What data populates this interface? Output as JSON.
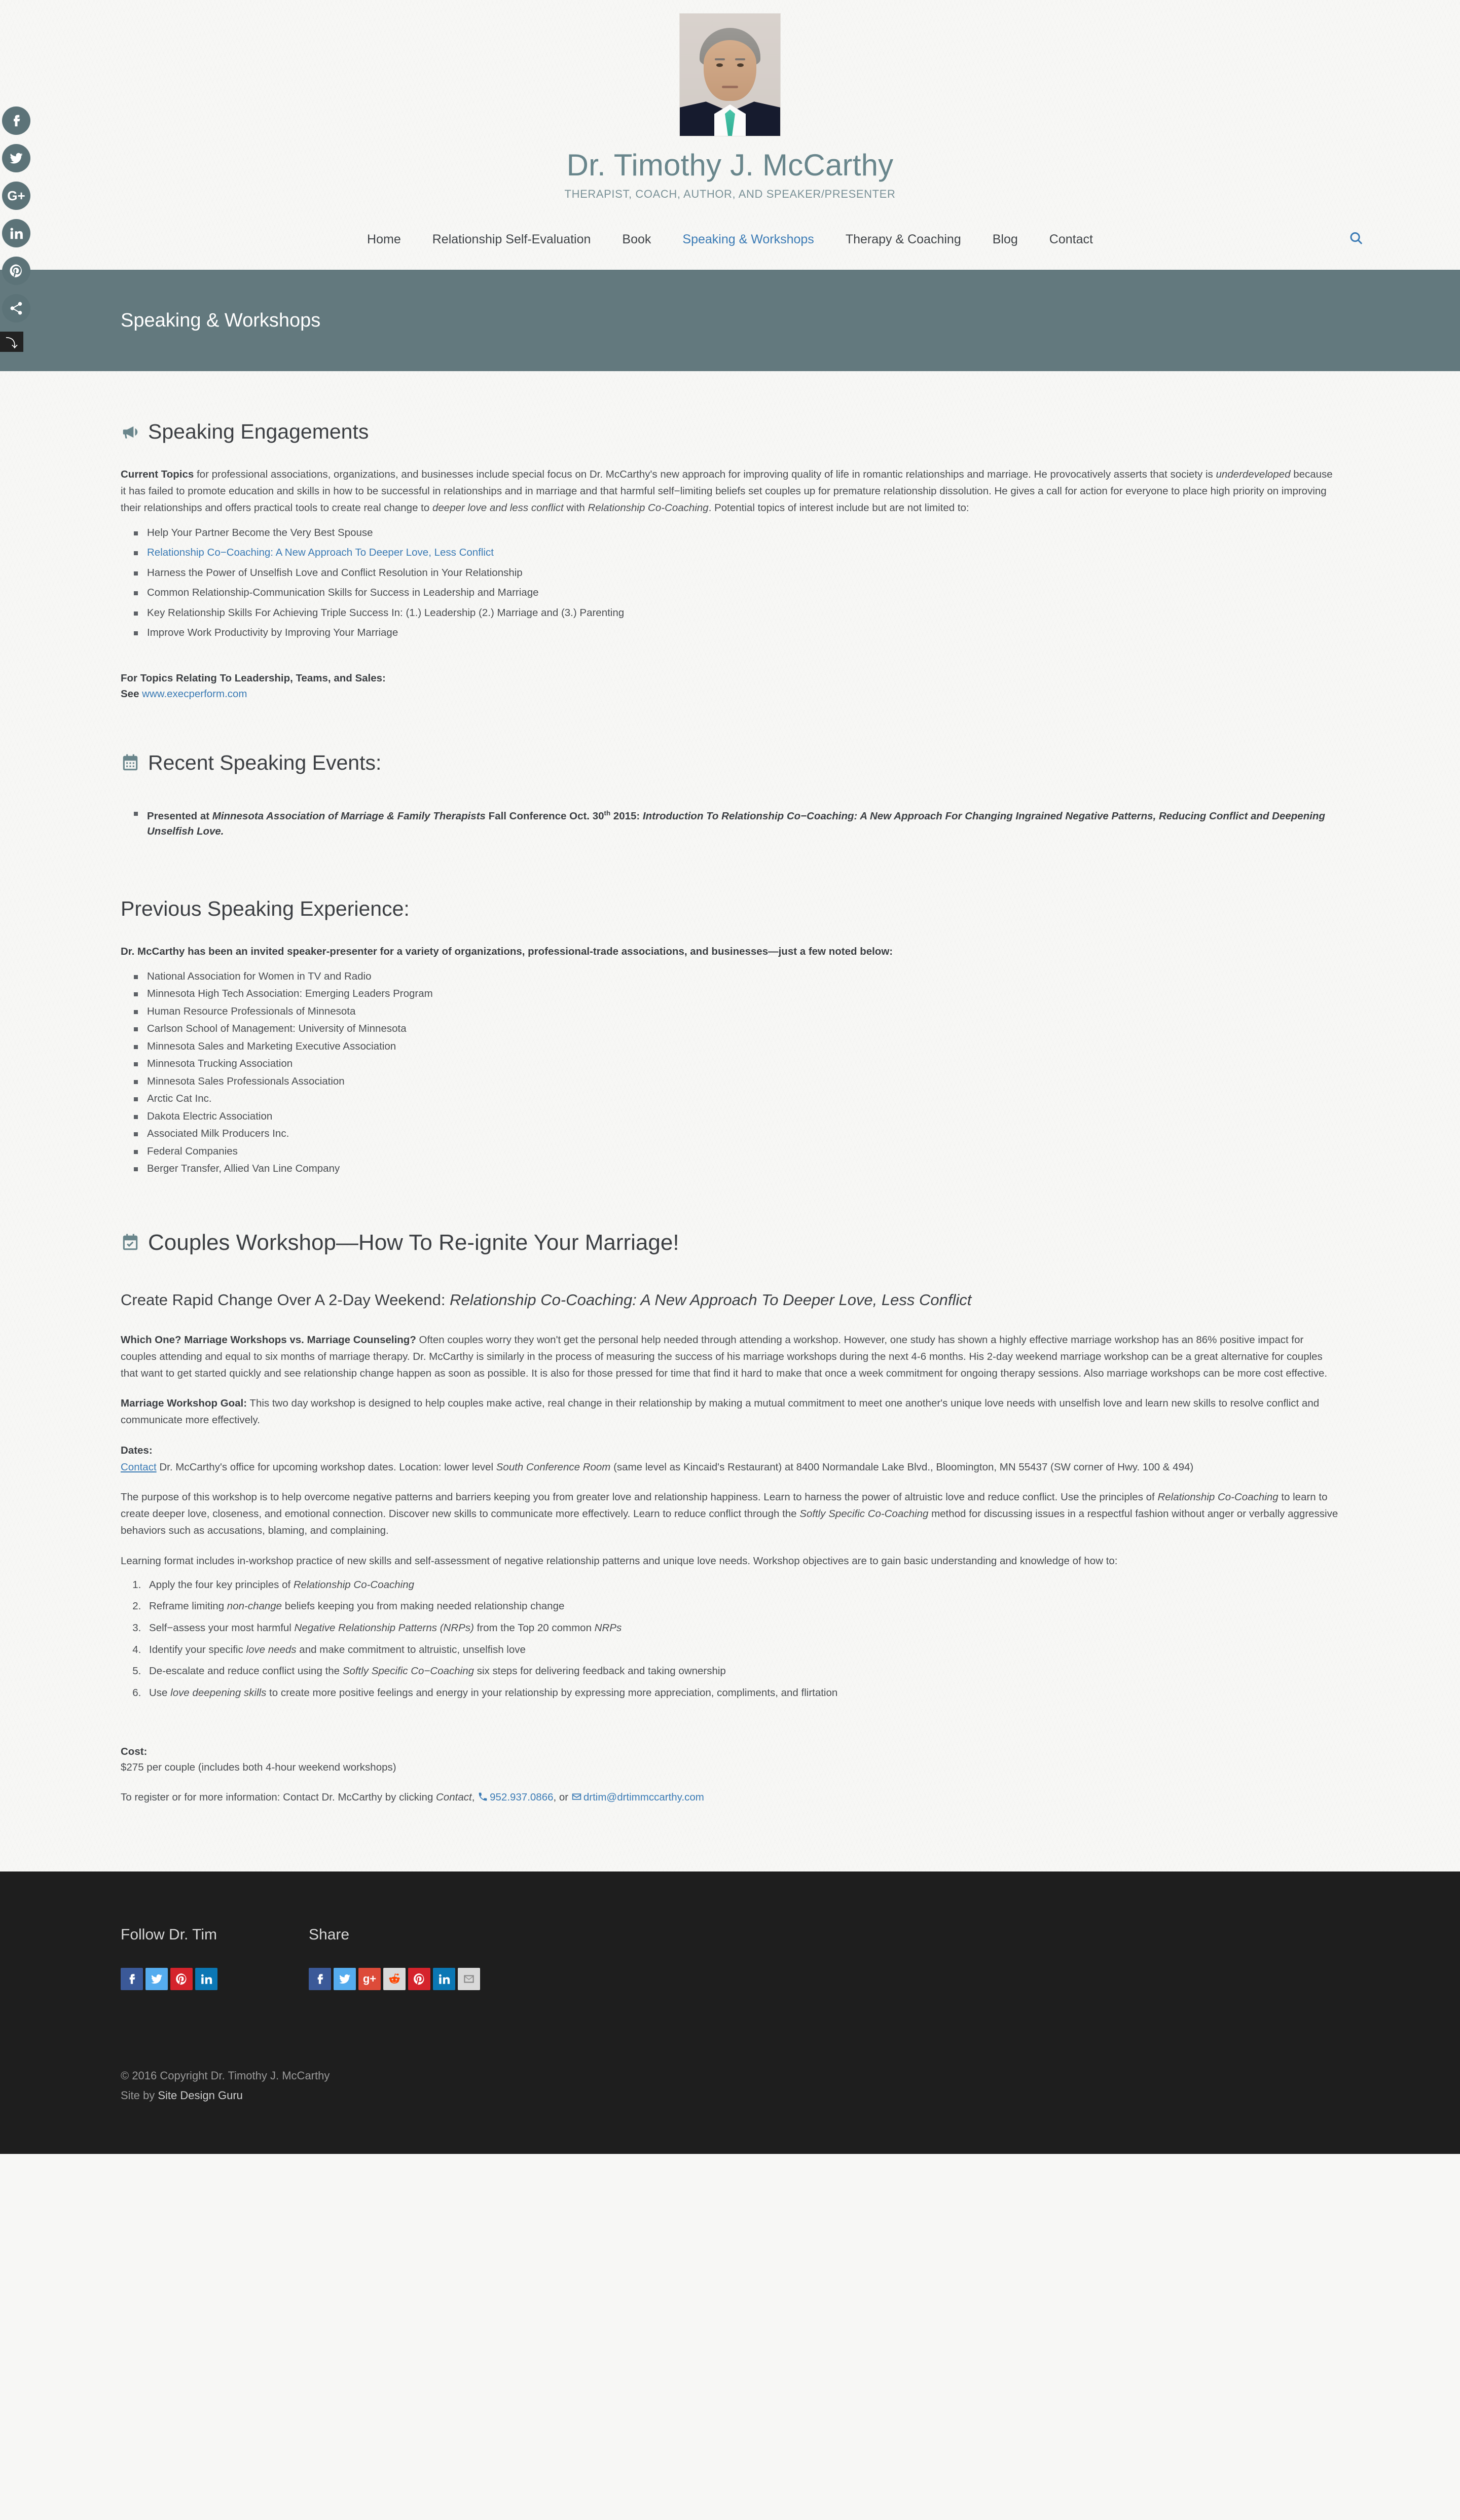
{
  "site": {
    "title": "Dr. Timothy J. McCarthy",
    "tagline": "THERAPIST, COACH, AUTHOR, AND SPEAKER/PRESENTER",
    "portrait_alt": "Portrait of Dr. Timothy J. McCarthy",
    "accent_blue": "#3b7bb5",
    "accent_teal": "#63797e"
  },
  "social_rail": [
    {
      "name": "facebook-icon",
      "label": "f"
    },
    {
      "name": "twitter-icon",
      "label": "t"
    },
    {
      "name": "google-plus-icon",
      "label": "G+"
    },
    {
      "name": "linkedin-icon",
      "label": "in"
    },
    {
      "name": "pinterest-icon",
      "label": "P"
    },
    {
      "name": "share-icon",
      "label": "share"
    },
    {
      "name": "collapse-icon",
      "label": "↵"
    }
  ],
  "nav": {
    "items": [
      {
        "label": "Home",
        "active": false
      },
      {
        "label": "Relationship Self-Evaluation",
        "active": false
      },
      {
        "label": "Book",
        "active": false
      },
      {
        "label": "Speaking & Workshops",
        "active": true
      },
      {
        "label": "Therapy & Coaching",
        "active": false
      },
      {
        "label": "Blog",
        "active": false
      },
      {
        "label": "Contact",
        "active": false
      }
    ],
    "search_icon": "search-icon"
  },
  "banner": {
    "title": "Speaking & Workshops"
  },
  "speaking_engagements": {
    "icon": "bullhorn-icon",
    "heading": "Speaking Engagements",
    "intro_lead": "Current Topics",
    "intro_p1": " for professional associations, organizations, and businesses include special focus on Dr. McCarthy's new approach for improving quality of life in romantic relationships and marriage. He provocatively asserts that society is ",
    "intro_em1": "underdeveloped",
    "intro_p2": " because it has failed to promote education and skills in how to be successful in relationships and in marriage and that harmful self−limiting beliefs set couples up for premature relationship dissolution. He gives a call for action for everyone to place high priority on improving their relationships and offers practical tools to create real change to ",
    "intro_em2": "deeper love and less conflict",
    "intro_p3": " with ",
    "intro_em3": "Relationship Co-Coaching",
    "intro_p4": ". Potential topics of interest include but are not limited to:",
    "topics": [
      {
        "text": "Help Your Partner Become the Very Best Spouse",
        "link": false
      },
      {
        "text": "Relationship Co−Coaching: A New Approach To Deeper Love, Less Conflict",
        "link": true
      },
      {
        "text": "Harness the Power of Unselfish Love and Conflict Resolution in Your Relationship",
        "link": false
      },
      {
        "text": "Common Relationship-Communication Skills for Success in Leadership and Marriage",
        "link": false
      },
      {
        "text": "Key Relationship Skills For Achieving Triple Success In: (1.) Leadership (2.) Marriage and (3.) Parenting",
        "link": false
      },
      {
        "text": "Improve Work Productivity by Improving Your Marriage",
        "link": false
      }
    ],
    "leadership_heading": "For Topics Relating To Leadership, Teams, and Sales:",
    "leadership_see": "See ",
    "leadership_link": "www.execperform.com"
  },
  "recent_events": {
    "icon": "calendar-icon",
    "heading": "Recent Speaking Events:",
    "item_pre": "Presented at ",
    "item_em1": "Minnesota Association of Marriage & Family Therapists",
    "item_mid": " Fall Conference Oct. 30",
    "item_sup": "th",
    "item_year": " 2015: ",
    "item_em2": "Introduction To Relationship Co−Coaching: A New Approach For Changing Ingrained Negative Patterns, Reducing Conflict and Deepening Unselfish Love."
  },
  "previous_experience": {
    "heading": "Previous Speaking Experience:",
    "intro": "Dr. McCarthy has been an invited speaker-presenter for a variety of organizations, professional-trade associations, and businesses—just a few noted below:",
    "items": [
      "National Association for Women in TV and Radio",
      "Minnesota High Tech Association: Emerging Leaders Program",
      "Human Resource Professionals of Minnesota",
      "Carlson School of Management: University of Minnesota",
      "Minnesota Sales and Marketing Executive Association",
      "Minnesota Trucking Association",
      "Minnesota Sales Professionals Association",
      "Arctic Cat Inc.",
      "Dakota Electric Association",
      "Associated Milk Producers Inc.",
      "Federal Companies",
      "Berger Transfer, Allied Van Line Company"
    ]
  },
  "couples_workshop": {
    "icon": "calendar-check-icon",
    "heading": "Couples Workshop—How To Re-ignite Your Marriage!",
    "subheading_plain": "Create Rapid Change Over A 2-Day Weekend: ",
    "subheading_em": "Relationship Co-Coaching: A New Approach To Deeper Love, Less Conflict",
    "which_one_lead": "Which One? Marriage Workshops vs. Marriage Counseling?",
    "which_one_body": " Often couples worry they won't get the personal help needed through attending a workshop. However, one study has shown a highly effective marriage workshop has an 86% positive impact for couples attending and equal to six months of marriage therapy. Dr. McCarthy is similarly in the process of measuring the success of his marriage workshops during the next 4-6 months. His 2-day weekend marriage workshop can be a great alternative for couples that want to get started quickly and see relationship change happen as soon as possible. It is also for those pressed for time that find it hard to make that once a week commitment for ongoing therapy sessions. Also marriage workshops can be more cost effective.",
    "goal_lead": "Marriage Workshop Goal:",
    "goal_body": " This two day workshop is designed to help couples make active, real change in their relationship by making a mutual commitment to meet one another's unique love needs with unselfish love and learn new skills to resolve conflict and communicate more effectively.",
    "dates_heading": "Dates:",
    "dates_link": "Contact",
    "dates_p1": " Dr. McCarthy's office for upcoming workshop dates. Location: lower level ",
    "dates_em": "South Conference Room",
    "dates_p2": " (same level as Kincaid's Restaurant) at 8400 Normandale Lake Blvd., Bloomington, MN 55437 (SW corner of Hwy. 100 & 494)",
    "purpose_p1": "The purpose of this workshop is to help overcome negative patterns and barriers keeping you from greater love and relationship happiness. Learn to harness the power of altruistic love and reduce conflict. Use the principles of ",
    "purpose_em1": "Relationship Co-Coaching",
    "purpose_p2": " to learn to create deeper love, closeness, and emotional connection. Discover new skills to communicate more effectively. Learn to reduce conflict through the ",
    "purpose_em2": "Softly Specific Co-Coaching",
    "purpose_p3": " method for discussing issues in a respectful fashion without anger or verbally aggressive behaviors such as accusations, blaming, and complaining.",
    "format_p": "Learning format includes in-workshop practice of new skills and self-assessment of negative relationship patterns and unique love needs. Workshop objectives are to gain basic understanding and knowledge of how to:",
    "objectives": [
      {
        "pre": "Apply the four key principles of ",
        "em": "Relationship Co-Coaching",
        "post": ""
      },
      {
        "pre": "Reframe limiting ",
        "em": "non-change",
        "post": " beliefs keeping you from making needed relationship change"
      },
      {
        "pre": "Self−assess your most harmful ",
        "em": "Negative Relationship Patterns (NRPs)",
        "post": " from the Top 20 common ",
        "em2": "NRPs"
      },
      {
        "pre": "Identify your specific ",
        "em": "love needs",
        "post": " and make commitment to altruistic, unselfish love"
      },
      {
        "pre": "De-escalate and reduce conflict using the ",
        "em": "Softly Specific Co−Coaching",
        "post": " six steps for delivering feedback and taking ownership"
      },
      {
        "pre": "Use ",
        "em": "love deepening skills",
        "post": " to create more positive feelings and energy in your relationship by expressing more appreciation, compliments, and flirtation"
      }
    ],
    "cost_heading": "Cost:",
    "cost_value": "$275 per couple (includes both 4-hour weekend workshops)",
    "register_pre": "To register or for more information: Contact Dr. McCarthy by clicking ",
    "register_em": "Contact",
    "register_comma": ", ",
    "register_phone": "952.937.0866",
    "register_or": ", or ",
    "register_email": "drtimmccarthy.com",
    "register_email_full": "drtim@drtimmccarthy.com",
    "phone_icon": "phone-icon",
    "email_icon": "envelope-icon"
  },
  "footer": {
    "follow_heading": "Follow Dr. Tim",
    "share_heading": "Share",
    "follow_icons": [
      {
        "name": "facebook-icon",
        "label": "f",
        "color": "#3b5998"
      },
      {
        "name": "twitter-icon",
        "label": "t",
        "color": "#55acee"
      },
      {
        "name": "pinterest-icon",
        "label": "P",
        "color": "#d5232c"
      },
      {
        "name": "linkedin-icon",
        "label": "in",
        "color": "#0b77b4"
      }
    ],
    "share_icons": [
      {
        "name": "facebook-icon",
        "label": "f",
        "color": "#3b5998"
      },
      {
        "name": "twitter-icon",
        "label": "t",
        "color": "#55acee"
      },
      {
        "name": "google-plus-icon",
        "label": "g+",
        "color": "#dd4b39"
      },
      {
        "name": "reddit-icon",
        "label": "reddit",
        "color": "#d9d9d9"
      },
      {
        "name": "pinterest-icon",
        "label": "P",
        "color": "#d5232c"
      },
      {
        "name": "linkedin-icon",
        "label": "in",
        "color": "#0b77b4"
      },
      {
        "name": "email-icon",
        "label": "mail",
        "color": "#d9d9d9"
      }
    ],
    "copyright": "© 2016 Copyright Dr. Timothy J. McCarthy",
    "site_by_pre": "Site by ",
    "site_by_link": "Site Design Guru"
  }
}
